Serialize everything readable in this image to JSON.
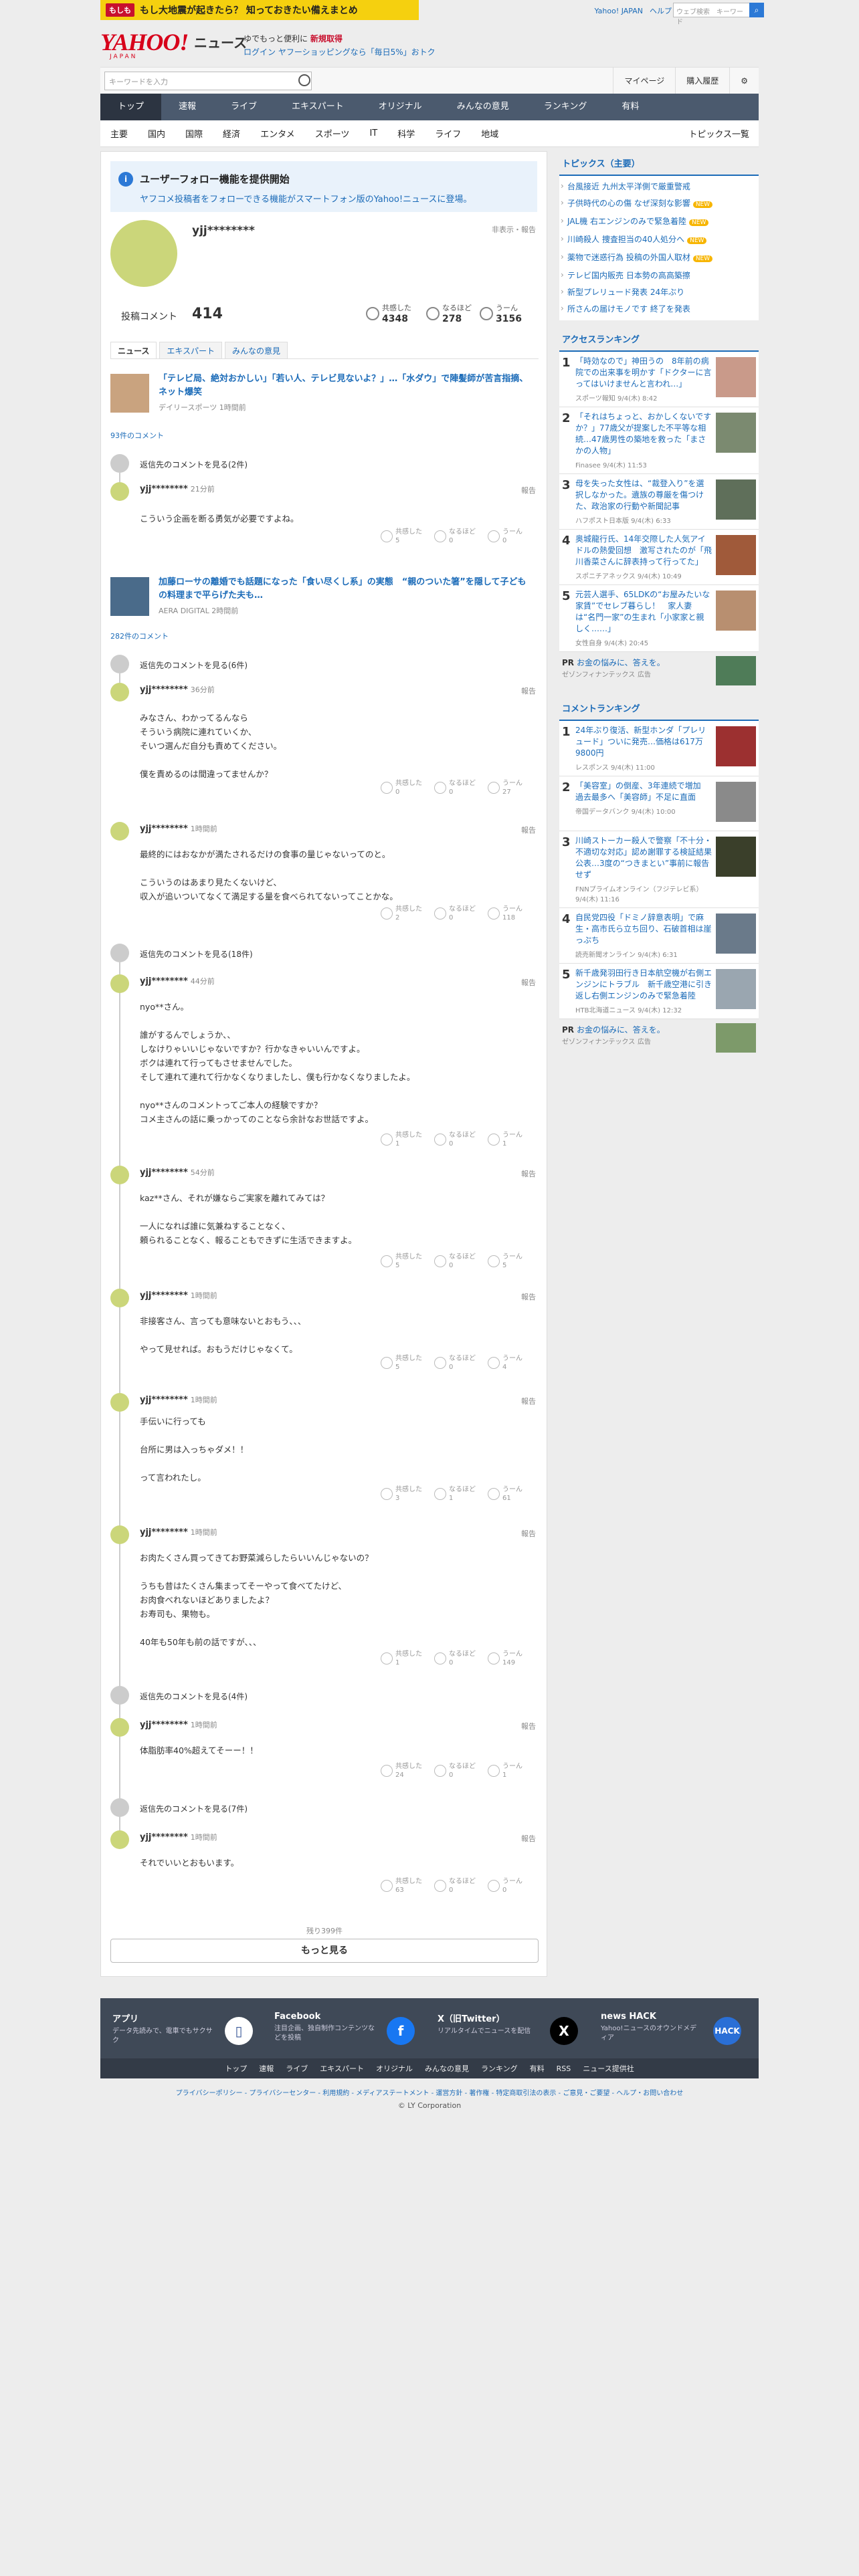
{
  "banner": {
    "badge": "もしも",
    "text": "もし大地震が起きたら？ 知っておきたい備えまとめ"
  },
  "toplinks": [
    "Yahoo! JAPAN",
    "ヘルプ"
  ],
  "topsearch_placeholder": "ウェブ検索　キーワード",
  "logo": {
    "main": "YAHOO!",
    "sub": "JAPAN",
    "news": "ニュース"
  },
  "promo": {
    "line1": "ゆでもっと便利に",
    "line1_red": "新規取得",
    "login": "ログイン",
    "line2": "ヤフーショッピングなら「毎日5%」おトク"
  },
  "toolbar": {
    "keyword_placeholder": "キーワードを入力",
    "mypage": "マイページ",
    "history": "購入履歴"
  },
  "gnav": [
    "トップ",
    "速報",
    "ライブ",
    "エキスパート",
    "オリジナル",
    "みんなの意見",
    "ランキング",
    "有料"
  ],
  "subnav": [
    "主要",
    "国内",
    "国際",
    "経済",
    "エンタメ",
    "スポーツ",
    "IT",
    "科学",
    "ライフ",
    "地域"
  ],
  "subnav_right": "トピックス一覧",
  "notice": {
    "title": "ユーザーフォロー機能を提供開始",
    "sub": "ヤフコメ投稿者をフォローできる機能がスマートフォン版のYahoo!ニュースに登場。"
  },
  "profile": {
    "username": "yjj********",
    "hidden": "非表示・報告",
    "count_label": "投稿コメント",
    "count": "414"
  },
  "reactions": [
    {
      "label": "共感した",
      "value": "4348"
    },
    {
      "label": "なるほど",
      "value": "278"
    },
    {
      "label": "うーん",
      "value": "3156"
    }
  ],
  "tabs": [
    "ニュース",
    "エキスパート",
    "みんなの意見"
  ],
  "articles": [
    {
      "title": "「テレビ局、絶対おかしい」「若い人、テレビ見ないよ？」…「水ダウ」で陣髪師が苦言指摘、ネット爆笑",
      "meta": "デイリースポーツ 1時間前",
      "comments": "93件のコメント"
    },
    {
      "title": "加藤ローサの離婚でも話題になった「食い尽くし系」の実態　“親のついた箸”を隠して子どもの料理まで平らげた夫も…",
      "meta": "AERA DIGITAL 2時間前",
      "comments": "282件のコメント"
    }
  ],
  "collapse": [
    "返信先のコメントを見る(2件)",
    "返信先のコメントを見る(6件)",
    "返信先のコメントを見る(18件)",
    "返信先のコメントを見る(4件)",
    "返信先のコメントを見る(7件)"
  ],
  "comments": [
    {
      "user": "yjj********",
      "time": "21分前",
      "report": "報告",
      "body": "こういう企画を断る勇気が必要ですよね。",
      "r": [
        "5",
        "0",
        "0"
      ]
    },
    {
      "user": "yjj********",
      "time": "36分前",
      "report": "報告",
      "body": "みなさん、わかってるんなら\nそういう病院に連れていくか、\nそいつ選んだ自分も責めてください。\n\n僕を責めるのは間違ってませんか？",
      "r": [
        "0",
        "0",
        "27"
      ]
    },
    {
      "user": "yjj********",
      "time": "1時間前",
      "report": "報告",
      "body": "最終的にはおなかが満たされるだけの食事の量じゃないってのと。\n\nこういうのはあまり見たくないけど、\n収入が追いついてなくて満足する量を食べられてないってことかな。",
      "r": [
        "2",
        "0",
        "118"
      ]
    },
    {
      "user": "yjj********",
      "time": "44分前",
      "report": "報告",
      "body": "nyo**さん。\n\n誰がするんでしょうか、、\nしなけりゃいいじゃないですか？行かなきゃいいんですよ。\nボクは連れて行ってもさせませんでした。\nそして連れて連れて行かなくなりましたし、僕も行かなくなりましたよ。\n\nnyo**さんのコメントってご本人の経験ですか？\nコメ主さんの話に乗っかってのことなら余計なお世話ですよ。",
      "r": [
        "1",
        "0",
        "1"
      ]
    },
    {
      "user": "yjj********",
      "time": "54分前",
      "report": "報告",
      "body": "kaz**さん、それが嫌ならご実家を離れてみては？\n\n一人になれば誰に気兼ねすることなく、\n頼られることなく、報ることもできずに生活できますよ。",
      "r": [
        "5",
        "0",
        "5"
      ]
    },
    {
      "user": "yjj********",
      "time": "1時間前",
      "report": "報告",
      "body": "非接客さん、言っても意味ないとおもう、、、\n\nやって見せれば。おもうだけじゃなくて。",
      "r": [
        "5",
        "0",
        "4"
      ]
    },
    {
      "user": "yjj********",
      "time": "1時間前",
      "report": "報告",
      "body": "手伝いに行っても\n\n台所に男は入っちゃダメ！！\n\nって言われたし。",
      "r": [
        "3",
        "1",
        "61"
      ]
    },
    {
      "user": "yjj********",
      "time": "1時間前",
      "report": "報告",
      "body": "お肉たくさん買ってきてお野菜減らしたらいいんじゃないの？\n\nうちも昔はたくさん集まってそーやって食べてたけど、\nお肉食べれないほどありましたよ？\nお寿司も、果物も。\n\n40年も50年も前の話ですが、、、",
      "r": [
        "1",
        "0",
        "149"
      ]
    },
    {
      "user": "yjj********",
      "time": "1時間前",
      "report": "報告",
      "body": "体脂肪率40%超えてそーー！！",
      "r": [
        "24",
        "0",
        "1"
      ]
    },
    {
      "user": "yjj********",
      "time": "1時間前",
      "report": "報告",
      "body": "それでいいとおもいます。",
      "r": [
        "63",
        "0",
        "0"
      ]
    }
  ],
  "react_labels": [
    "共感した",
    "なるほど",
    "うーん"
  ],
  "remain": "残り399件",
  "more": "もっと見る",
  "side": {
    "topics_head": "トピックス（主要）",
    "topics": [
      {
        "t": "台風接近 九州太平洋側で厳重警戒",
        "new": ""
      },
      {
        "t": "子供時代の心の傷 なぜ深刻な影響",
        "new": "NEW"
      },
      {
        "t": "JAL機 右エンジンのみで緊急着陸",
        "new": "NEW"
      },
      {
        "t": "川崎殺人 捜査担当の40人処分へ",
        "new": "NEW"
      },
      {
        "t": "薬物で迷惑行為 投稿の外国人取材",
        "new": "NEW"
      },
      {
        "t": "テレビ国内販売 日本勢の高高築擦",
        "new": ""
      },
      {
        "t": "新型プレリュード発表 24年ぶり",
        "new": ""
      },
      {
        "t": "所さんの届けモノです 終了を発表",
        "new": ""
      }
    ],
    "access_head": "アクセスランキング",
    "access": [
      {
        "no": "1",
        "t": "「時効なので」神田うの　8年前の病院での出来事を明かす「ドクターに言ってはいけませんと言われ…」",
        "m": "スポーツ報知 9/4(木) 8:42"
      },
      {
        "no": "2",
        "t": "「それはちょっと、おかしくないですか？」77歳父が提案した不平等な相続…47歳男性の築地を救った「まさかの人物」",
        "m": "Finasee 9/4(木) 11:53"
      },
      {
        "no": "3",
        "t": "母を失った女性は、“裁登入り”を選択しなかった。遺族の尊厳を傷つけた、政治家の行動や新聞記事",
        "m": "ハフポスト日本版 9/4(木) 6:33"
      },
      {
        "no": "4",
        "t": "奥城龍行氏、14年交際した人気アイドルの熱愛回想　激写されたのが「飛川香菜さんに辞表持って行ってた」",
        "m": "スポニチアネックス 9/4(木) 10:49"
      },
      {
        "no": "5",
        "t": "元芸人選手、65LDKの“お屋みたいな家賃”でセレブ暮らし！　家人妻は“名門一家”の生まれ「小家家と親しく……」",
        "m": "女性自身 9/4(木) 20:45"
      }
    ],
    "pr1": {
      "tag": "PR",
      "t": "お金の悩みに、答えを。",
      "sp": "ゼゾンフィナンテックス",
      "ad": "広告"
    },
    "comment_head": "コメントランキング",
    "comment": [
      {
        "no": "1",
        "t": "24年ぶり復活、新型ホンダ「プレリュード」ついに発売…価格は617万9800円",
        "m": "レスポンス 9/4(木) 11:00"
      },
      {
        "no": "2",
        "t": "「美容室」の倒産、3年連続で増加　過去最多へ「美容師」不足に直面",
        "m": "帝国データバンク 9/4(木) 10:00"
      },
      {
        "no": "3",
        "t": "川崎ストーカー殺人で警察「不十分・不適切な対応」認め謝罪する検証結果公表…3度の“つきまとい”事前に報告せず",
        "m": "FNNプライムオンライン（フジテレビ系） 9/4(木) 11:16"
      },
      {
        "no": "4",
        "t": "自民党四役「ドミノ辞意表明」で麻生・高市氏ら立ち回り、石破首相は崖っぷち",
        "m": "読売新聞オンライン 9/4(木) 6:31"
      },
      {
        "no": "5",
        "t": "新千歳発羽田行き日本航空機が右側エンジンにトラブル　新千歳空港に引き返し右側エンジンのみで緊急着陸",
        "m": "HTB北海道ニュース 9/4(木) 12:32"
      }
    ],
    "pr2": {
      "tag": "PR",
      "t": "お金の悩みに、答えを。",
      "sp": "ゼゾンフィナンテックス",
      "ad": "広告"
    }
  },
  "footer": {
    "apps": [
      {
        "h": "アプリ",
        "d": "データ先読みで、電車でもサクサク",
        "i": "📱"
      },
      {
        "h": "Facebook",
        "d": "注目企画、独自制作コンテンツなどを投稿",
        "i": "f"
      },
      {
        "h": "X（旧Twitter）",
        "d": "リアルタイムでニュースを配信",
        "i": "X"
      },
      {
        "h": "news HACK",
        "d": "Yahoo!ニュースのオウンドメディア",
        "i": "H"
      }
    ],
    "nav": [
      "トップ",
      "速報",
      "ライブ",
      "エキスパート",
      "オリジナル",
      "みんなの意見",
      "ランキング",
      "有料",
      "RSS",
      "ニュース提供社"
    ],
    "legal": "プライバシーポリシー - プライバシーセンター - 利用規約 - メディアステートメント - 運営方針 - 著作権 - 特定商取引法の表示 - ご意見・ご要望 - ヘルプ・お問い合わせ",
    "copy": "© LY Corporation"
  }
}
